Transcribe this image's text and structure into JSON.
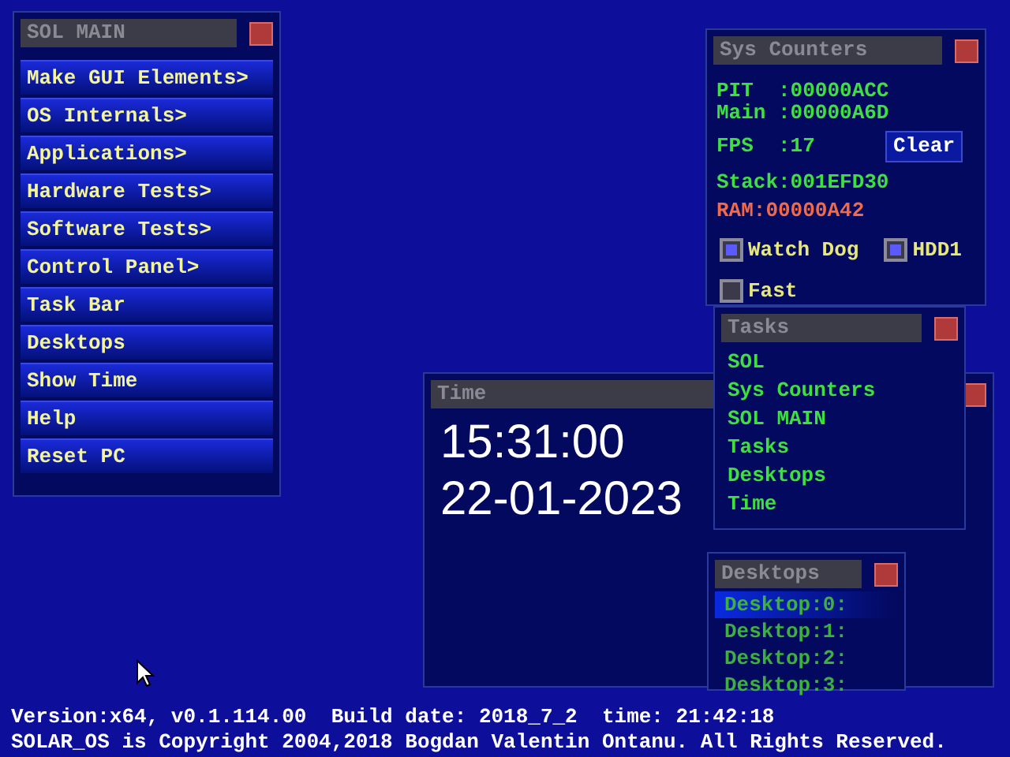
{
  "main_menu": {
    "title": "SOL MAIN",
    "items": [
      "Make GUI Elements>",
      "OS Internals>",
      "Applications>",
      "Hardware Tests>",
      "Software Tests>",
      "Control Panel>",
      "Task Bar",
      "Desktops",
      "Show Time",
      "Help",
      "Reset PC"
    ]
  },
  "sys_counters": {
    "title": "Sys Counters",
    "pit": "PIT  :00000ACC",
    "main": "Main :00000A6D",
    "fps": "FPS  :17",
    "clear_button": "Clear",
    "stack": "Stack:001EFD30",
    "ram": "RAM:00000A42",
    "options": [
      {
        "label": "Watch Dog",
        "checked": true
      },
      {
        "label": "HDD1",
        "checked": true
      },
      {
        "label": "Fast",
        "checked": false
      }
    ]
  },
  "time_window": {
    "title": "Time",
    "time": "15:31:00",
    "date": "22-01-2023"
  },
  "tasks": {
    "title": "Tasks",
    "items": [
      "SOL",
      "Sys Counters",
      "SOL MAIN",
      "Tasks",
      "Desktops",
      "Time"
    ]
  },
  "desktops": {
    "title": "Desktops",
    "items": [
      {
        "label": "Desktop:0:",
        "selected": true
      },
      {
        "label": "Desktop:1:",
        "selected": false
      },
      {
        "label": "Desktop:2:",
        "selected": false
      },
      {
        "label": "Desktop:3:",
        "selected": false
      }
    ]
  },
  "footer": {
    "version": "Version:x64, v0.1.114.00  Build date: 2018_7_2  time: 21:42:18",
    "copyright": "SOLAR_OS is Copyright 2004,2018 Bogdan Valentin Ontanu. All Rights Reserved."
  }
}
